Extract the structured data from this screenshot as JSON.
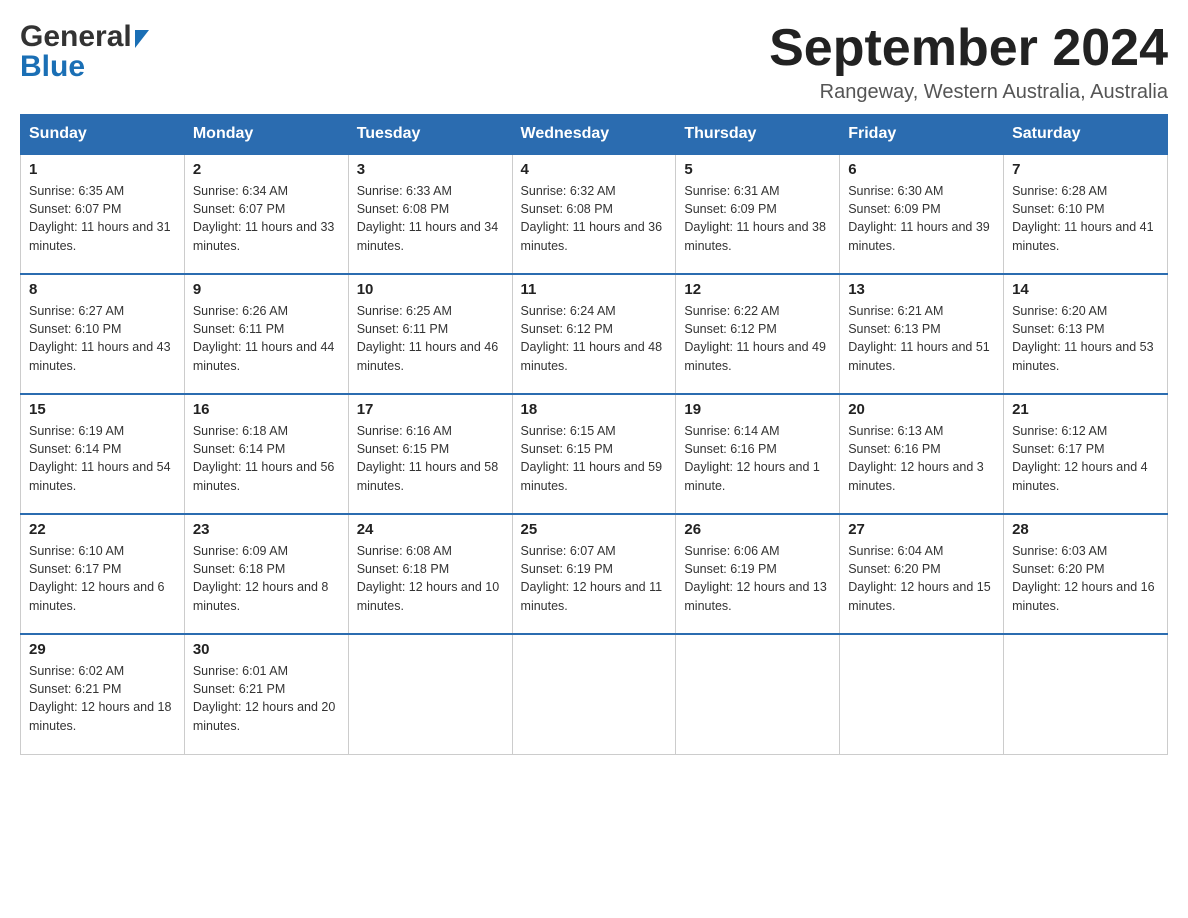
{
  "header": {
    "logo_general": "General",
    "logo_blue": "Blue",
    "month_title": "September 2024",
    "location": "Rangeway, Western Australia, Australia"
  },
  "days_of_week": [
    "Sunday",
    "Monday",
    "Tuesday",
    "Wednesday",
    "Thursday",
    "Friday",
    "Saturday"
  ],
  "weeks": [
    [
      {
        "day": "1",
        "sunrise": "6:35 AM",
        "sunset": "6:07 PM",
        "daylight": "11 hours and 31 minutes."
      },
      {
        "day": "2",
        "sunrise": "6:34 AM",
        "sunset": "6:07 PM",
        "daylight": "11 hours and 33 minutes."
      },
      {
        "day": "3",
        "sunrise": "6:33 AM",
        "sunset": "6:08 PM",
        "daylight": "11 hours and 34 minutes."
      },
      {
        "day": "4",
        "sunrise": "6:32 AM",
        "sunset": "6:08 PM",
        "daylight": "11 hours and 36 minutes."
      },
      {
        "day": "5",
        "sunrise": "6:31 AM",
        "sunset": "6:09 PM",
        "daylight": "11 hours and 38 minutes."
      },
      {
        "day": "6",
        "sunrise": "6:30 AM",
        "sunset": "6:09 PM",
        "daylight": "11 hours and 39 minutes."
      },
      {
        "day": "7",
        "sunrise": "6:28 AM",
        "sunset": "6:10 PM",
        "daylight": "11 hours and 41 minutes."
      }
    ],
    [
      {
        "day": "8",
        "sunrise": "6:27 AM",
        "sunset": "6:10 PM",
        "daylight": "11 hours and 43 minutes."
      },
      {
        "day": "9",
        "sunrise": "6:26 AM",
        "sunset": "6:11 PM",
        "daylight": "11 hours and 44 minutes."
      },
      {
        "day": "10",
        "sunrise": "6:25 AM",
        "sunset": "6:11 PM",
        "daylight": "11 hours and 46 minutes."
      },
      {
        "day": "11",
        "sunrise": "6:24 AM",
        "sunset": "6:12 PM",
        "daylight": "11 hours and 48 minutes."
      },
      {
        "day": "12",
        "sunrise": "6:22 AM",
        "sunset": "6:12 PM",
        "daylight": "11 hours and 49 minutes."
      },
      {
        "day": "13",
        "sunrise": "6:21 AM",
        "sunset": "6:13 PM",
        "daylight": "11 hours and 51 minutes."
      },
      {
        "day": "14",
        "sunrise": "6:20 AM",
        "sunset": "6:13 PM",
        "daylight": "11 hours and 53 minutes."
      }
    ],
    [
      {
        "day": "15",
        "sunrise": "6:19 AM",
        "sunset": "6:14 PM",
        "daylight": "11 hours and 54 minutes."
      },
      {
        "day": "16",
        "sunrise": "6:18 AM",
        "sunset": "6:14 PM",
        "daylight": "11 hours and 56 minutes."
      },
      {
        "day": "17",
        "sunrise": "6:16 AM",
        "sunset": "6:15 PM",
        "daylight": "11 hours and 58 minutes."
      },
      {
        "day": "18",
        "sunrise": "6:15 AM",
        "sunset": "6:15 PM",
        "daylight": "11 hours and 59 minutes."
      },
      {
        "day": "19",
        "sunrise": "6:14 AM",
        "sunset": "6:16 PM",
        "daylight": "12 hours and 1 minute."
      },
      {
        "day": "20",
        "sunrise": "6:13 AM",
        "sunset": "6:16 PM",
        "daylight": "12 hours and 3 minutes."
      },
      {
        "day": "21",
        "sunrise": "6:12 AM",
        "sunset": "6:17 PM",
        "daylight": "12 hours and 4 minutes."
      }
    ],
    [
      {
        "day": "22",
        "sunrise": "6:10 AM",
        "sunset": "6:17 PM",
        "daylight": "12 hours and 6 minutes."
      },
      {
        "day": "23",
        "sunrise": "6:09 AM",
        "sunset": "6:18 PM",
        "daylight": "12 hours and 8 minutes."
      },
      {
        "day": "24",
        "sunrise": "6:08 AM",
        "sunset": "6:18 PM",
        "daylight": "12 hours and 10 minutes."
      },
      {
        "day": "25",
        "sunrise": "6:07 AM",
        "sunset": "6:19 PM",
        "daylight": "12 hours and 11 minutes."
      },
      {
        "day": "26",
        "sunrise": "6:06 AM",
        "sunset": "6:19 PM",
        "daylight": "12 hours and 13 minutes."
      },
      {
        "day": "27",
        "sunrise": "6:04 AM",
        "sunset": "6:20 PM",
        "daylight": "12 hours and 15 minutes."
      },
      {
        "day": "28",
        "sunrise": "6:03 AM",
        "sunset": "6:20 PM",
        "daylight": "12 hours and 16 minutes."
      }
    ],
    [
      {
        "day": "29",
        "sunrise": "6:02 AM",
        "sunset": "6:21 PM",
        "daylight": "12 hours and 18 minutes."
      },
      {
        "day": "30",
        "sunrise": "6:01 AM",
        "sunset": "6:21 PM",
        "daylight": "12 hours and 20 minutes."
      },
      null,
      null,
      null,
      null,
      null
    ]
  ],
  "labels": {
    "sunrise": "Sunrise:",
    "sunset": "Sunset:",
    "daylight": "Daylight:"
  }
}
